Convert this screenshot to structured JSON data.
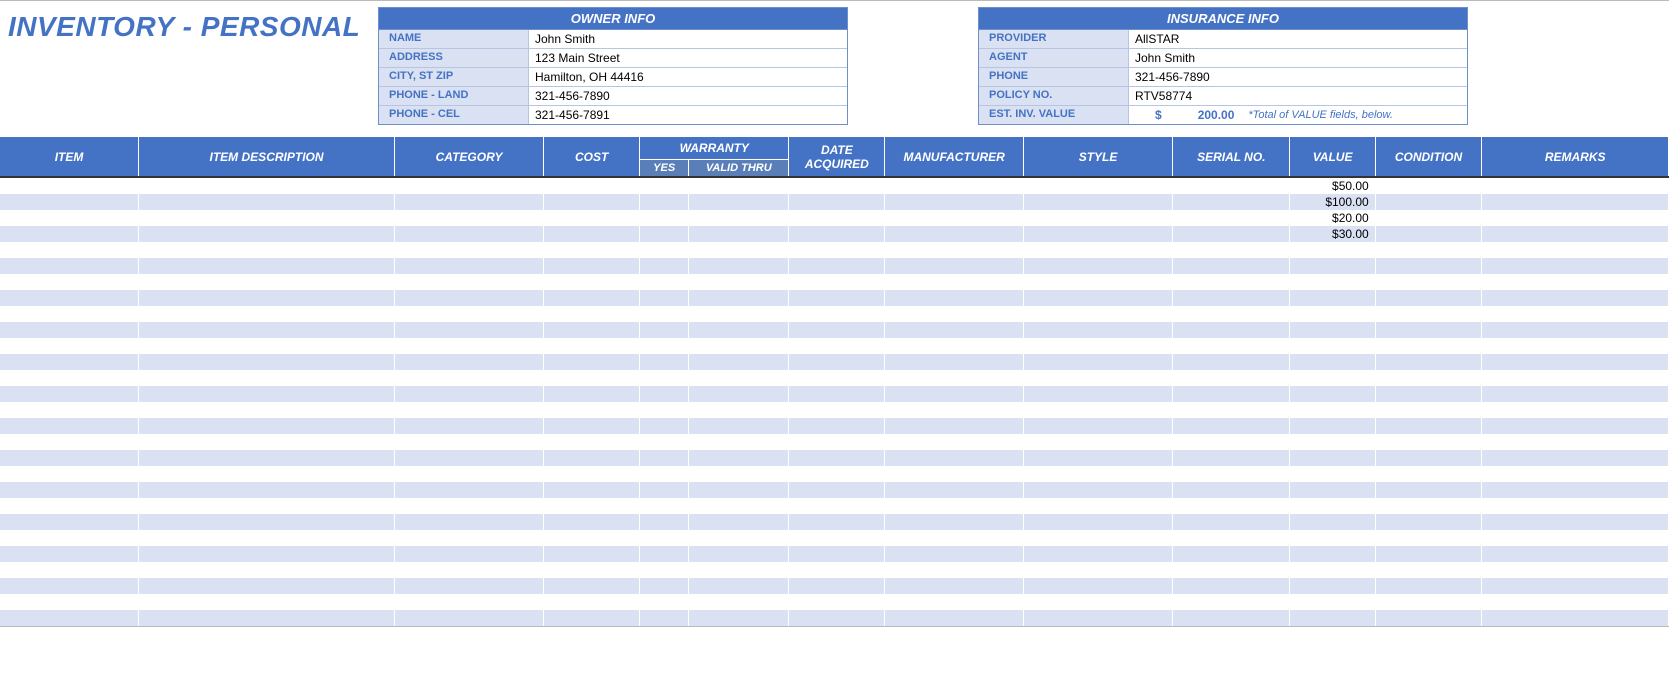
{
  "title": "INVENTORY - PERSONAL",
  "owner": {
    "header": "OWNER INFO",
    "rows": [
      {
        "label": "NAME",
        "value": "John Smith"
      },
      {
        "label": "ADDRESS",
        "value": "123 Main Street"
      },
      {
        "label": "CITY, ST  ZIP",
        "value": "Hamilton, OH  44416"
      },
      {
        "label": "PHONE - LAND",
        "value": "321-456-7890"
      },
      {
        "label": "PHONE - CEL",
        "value": "321-456-7891"
      }
    ]
  },
  "insurance": {
    "header": "INSURANCE INFO",
    "rows": [
      {
        "label": "PROVIDER",
        "value": "AllSTAR"
      },
      {
        "label": "AGENT",
        "value": "John Smith"
      },
      {
        "label": "PHONE",
        "value": "321-456-7890"
      },
      {
        "label": "POLICY NO.",
        "value": "RTV58774"
      }
    ],
    "est_label": "EST. INV. VALUE",
    "est_currency": "$",
    "est_amount": "200.00",
    "est_note": "*Total of VALUE fields, below."
  },
  "columns": {
    "item": "ITEM",
    "desc": "ITEM DESCRIPTION",
    "cat": "CATEGORY",
    "cost": "COST",
    "warranty": "WARRANTY",
    "wyes": "YES",
    "wthru": "VALID THRU",
    "date": "DATE ACQUIRED",
    "mfr": "MANUFACTURER",
    "style": "STYLE",
    "serial": "SERIAL NO.",
    "value": "VALUE",
    "cond": "CONDITION",
    "remarks": "REMARKS"
  },
  "rows": [
    {
      "item": "",
      "desc": "",
      "cat": "",
      "cost": "",
      "wyes": "",
      "wthru": "",
      "date": "",
      "mfr": "",
      "style": "",
      "serial": "",
      "value": "$50.00",
      "cond": "",
      "remarks": ""
    },
    {
      "item": "",
      "desc": "",
      "cat": "",
      "cost": "",
      "wyes": "",
      "wthru": "",
      "date": "",
      "mfr": "",
      "style": "",
      "serial": "",
      "value": "$100.00",
      "cond": "",
      "remarks": ""
    },
    {
      "item": "",
      "desc": "",
      "cat": "",
      "cost": "",
      "wyes": "",
      "wthru": "",
      "date": "",
      "mfr": "",
      "style": "",
      "serial": "",
      "value": "$20.00",
      "cond": "",
      "remarks": ""
    },
    {
      "item": "",
      "desc": "",
      "cat": "",
      "cost": "",
      "wyes": "",
      "wthru": "",
      "date": "",
      "mfr": "",
      "style": "",
      "serial": "",
      "value": "$30.00",
      "cond": "",
      "remarks": ""
    },
    {
      "item": "",
      "desc": "",
      "cat": "",
      "cost": "",
      "wyes": "",
      "wthru": "",
      "date": "",
      "mfr": "",
      "style": "",
      "serial": "",
      "value": "",
      "cond": "",
      "remarks": ""
    },
    {
      "item": "",
      "desc": "",
      "cat": "",
      "cost": "",
      "wyes": "",
      "wthru": "",
      "date": "",
      "mfr": "",
      "style": "",
      "serial": "",
      "value": "",
      "cond": "",
      "remarks": ""
    },
    {
      "item": "",
      "desc": "",
      "cat": "",
      "cost": "",
      "wyes": "",
      "wthru": "",
      "date": "",
      "mfr": "",
      "style": "",
      "serial": "",
      "value": "",
      "cond": "",
      "remarks": ""
    },
    {
      "item": "",
      "desc": "",
      "cat": "",
      "cost": "",
      "wyes": "",
      "wthru": "",
      "date": "",
      "mfr": "",
      "style": "",
      "serial": "",
      "value": "",
      "cond": "",
      "remarks": ""
    },
    {
      "item": "",
      "desc": "",
      "cat": "",
      "cost": "",
      "wyes": "",
      "wthru": "",
      "date": "",
      "mfr": "",
      "style": "",
      "serial": "",
      "value": "",
      "cond": "",
      "remarks": ""
    },
    {
      "item": "",
      "desc": "",
      "cat": "",
      "cost": "",
      "wyes": "",
      "wthru": "",
      "date": "",
      "mfr": "",
      "style": "",
      "serial": "",
      "value": "",
      "cond": "",
      "remarks": ""
    },
    {
      "item": "",
      "desc": "",
      "cat": "",
      "cost": "",
      "wyes": "",
      "wthru": "",
      "date": "",
      "mfr": "",
      "style": "",
      "serial": "",
      "value": "",
      "cond": "",
      "remarks": ""
    },
    {
      "item": "",
      "desc": "",
      "cat": "",
      "cost": "",
      "wyes": "",
      "wthru": "",
      "date": "",
      "mfr": "",
      "style": "",
      "serial": "",
      "value": "",
      "cond": "",
      "remarks": ""
    },
    {
      "item": "",
      "desc": "",
      "cat": "",
      "cost": "",
      "wyes": "",
      "wthru": "",
      "date": "",
      "mfr": "",
      "style": "",
      "serial": "",
      "value": "",
      "cond": "",
      "remarks": ""
    },
    {
      "item": "",
      "desc": "",
      "cat": "",
      "cost": "",
      "wyes": "",
      "wthru": "",
      "date": "",
      "mfr": "",
      "style": "",
      "serial": "",
      "value": "",
      "cond": "",
      "remarks": ""
    },
    {
      "item": "",
      "desc": "",
      "cat": "",
      "cost": "",
      "wyes": "",
      "wthru": "",
      "date": "",
      "mfr": "",
      "style": "",
      "serial": "",
      "value": "",
      "cond": "",
      "remarks": ""
    },
    {
      "item": "",
      "desc": "",
      "cat": "",
      "cost": "",
      "wyes": "",
      "wthru": "",
      "date": "",
      "mfr": "",
      "style": "",
      "serial": "",
      "value": "",
      "cond": "",
      "remarks": ""
    },
    {
      "item": "",
      "desc": "",
      "cat": "",
      "cost": "",
      "wyes": "",
      "wthru": "",
      "date": "",
      "mfr": "",
      "style": "",
      "serial": "",
      "value": "",
      "cond": "",
      "remarks": ""
    },
    {
      "item": "",
      "desc": "",
      "cat": "",
      "cost": "",
      "wyes": "",
      "wthru": "",
      "date": "",
      "mfr": "",
      "style": "",
      "serial": "",
      "value": "",
      "cond": "",
      "remarks": ""
    },
    {
      "item": "",
      "desc": "",
      "cat": "",
      "cost": "",
      "wyes": "",
      "wthru": "",
      "date": "",
      "mfr": "",
      "style": "",
      "serial": "",
      "value": "",
      "cond": "",
      "remarks": ""
    },
    {
      "item": "",
      "desc": "",
      "cat": "",
      "cost": "",
      "wyes": "",
      "wthru": "",
      "date": "",
      "mfr": "",
      "style": "",
      "serial": "",
      "value": "",
      "cond": "",
      "remarks": ""
    },
    {
      "item": "",
      "desc": "",
      "cat": "",
      "cost": "",
      "wyes": "",
      "wthru": "",
      "date": "",
      "mfr": "",
      "style": "",
      "serial": "",
      "value": "",
      "cond": "",
      "remarks": ""
    },
    {
      "item": "",
      "desc": "",
      "cat": "",
      "cost": "",
      "wyes": "",
      "wthru": "",
      "date": "",
      "mfr": "",
      "style": "",
      "serial": "",
      "value": "",
      "cond": "",
      "remarks": ""
    },
    {
      "item": "",
      "desc": "",
      "cat": "",
      "cost": "",
      "wyes": "",
      "wthru": "",
      "date": "",
      "mfr": "",
      "style": "",
      "serial": "",
      "value": "",
      "cond": "",
      "remarks": ""
    },
    {
      "item": "",
      "desc": "",
      "cat": "",
      "cost": "",
      "wyes": "",
      "wthru": "",
      "date": "",
      "mfr": "",
      "style": "",
      "serial": "",
      "value": "",
      "cond": "",
      "remarks": ""
    },
    {
      "item": "",
      "desc": "",
      "cat": "",
      "cost": "",
      "wyes": "",
      "wthru": "",
      "date": "",
      "mfr": "",
      "style": "",
      "serial": "",
      "value": "",
      "cond": "",
      "remarks": ""
    },
    {
      "item": "",
      "desc": "",
      "cat": "",
      "cost": "",
      "wyes": "",
      "wthru": "",
      "date": "",
      "mfr": "",
      "style": "",
      "serial": "",
      "value": "",
      "cond": "",
      "remarks": ""
    },
    {
      "item": "",
      "desc": "",
      "cat": "",
      "cost": "",
      "wyes": "",
      "wthru": "",
      "date": "",
      "mfr": "",
      "style": "",
      "serial": "",
      "value": "",
      "cond": "",
      "remarks": ""
    },
    {
      "item": "",
      "desc": "",
      "cat": "",
      "cost": "",
      "wyes": "",
      "wthru": "",
      "date": "",
      "mfr": "",
      "style": "",
      "serial": "",
      "value": "",
      "cond": "",
      "remarks": ""
    }
  ]
}
